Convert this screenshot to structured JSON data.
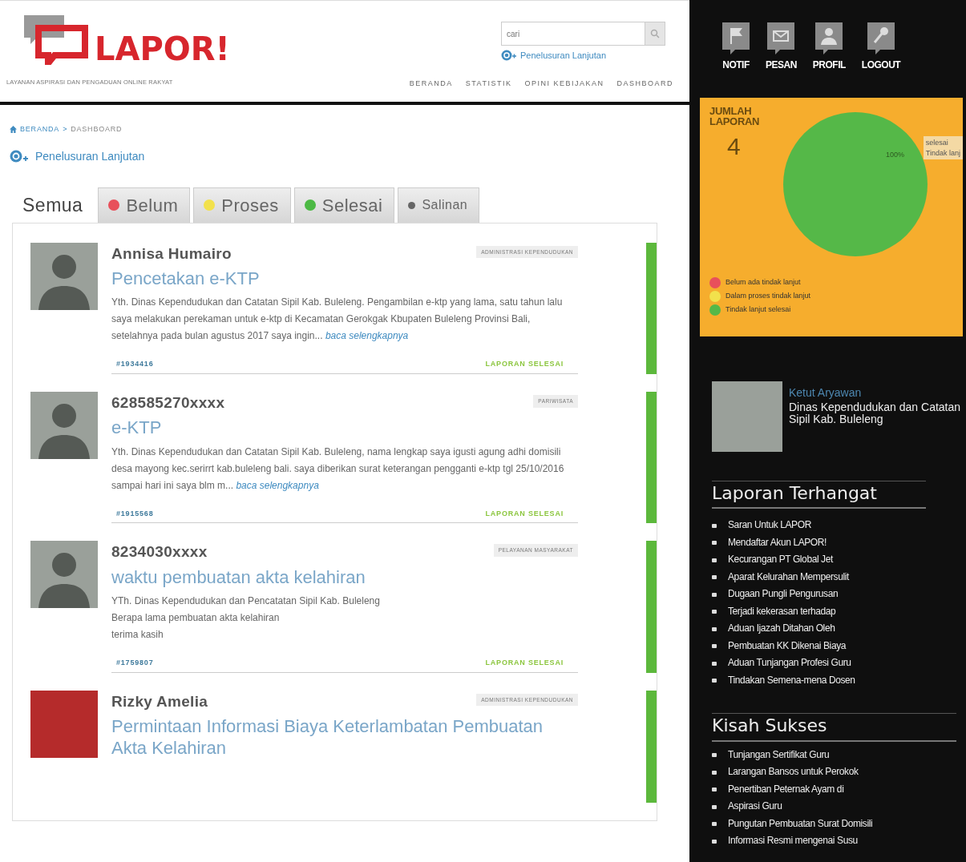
{
  "header": {
    "logo_text": "LAPOR!",
    "tagline": "LAYANAN ASPIRASI DAN PENGADUAN ONLINE RAKYAT",
    "search": {
      "placeholder": "cari"
    },
    "advanced_search": "Penelusuran Lanjutan",
    "nav": [
      "BERANDA",
      "STATISTIK",
      "OPINI KEBIJAKAN",
      "DASHBOARD"
    ]
  },
  "breadcrumb": {
    "items": [
      "BERANDA",
      "DASHBOARD"
    ],
    "separator": ">"
  },
  "advanced_search": "Penelusuran Lanjutan",
  "tabs": [
    {
      "label": "Semua",
      "selected": true
    },
    {
      "label": "Belum",
      "selected": false,
      "color": "#e8505b"
    },
    {
      "label": "Proses",
      "selected": false,
      "color": "#f2e14c"
    },
    {
      "label": "Selesai",
      "selected": false,
      "color": "#4cb944"
    },
    {
      "label": "Salinan",
      "selected": false,
      "color": "#666666"
    }
  ],
  "reports": [
    {
      "author": "Annisa Humairo",
      "has_photo": false,
      "category": "ADMINISTRASI KEPENDUDUKAN",
      "title": "Pencetakan e-KTP",
      "body": "Yth. Dinas Kependudukan dan Catatan Sipil Kab. Buleleng. Pengambilan e-ktp yang lama, satu tahun lalu saya melakukan perekaman untuk e-ktp di Kecamatan Gerokgak Kbupaten Buleleng Provinsi Bali, setelahnya pada bulan agustus 2017 saya ingin...",
      "read_more": "baca selengkapnya",
      "id": "#1934416",
      "status": "LAPORAN SELESAI",
      "color": "#5cb83c"
    },
    {
      "author": "628585270xxxx",
      "has_photo": false,
      "category": "PARIWISATA",
      "title": "e-KTP",
      "body": "Yth. Dinas Kependudukan dan Catatan Sipil Kab. Buleleng, nama lengkap saya igusti agung adhi domisili desa mayong kec.serirrt kab.buleleng bali. saya diberikan surat keterangan pengganti e-ktp tgl 25/10/2016 sampai hari ini saya blm m...",
      "read_more": "baca selengkapnya",
      "id": "#1915568",
      "status": "LAPORAN SELESAI",
      "color": "#5cb83c"
    },
    {
      "author": "8234030xxxx",
      "has_photo": false,
      "category": "PELAYANAN MASYARAKAT",
      "title": "waktu pembuatan akta kelahiran",
      "body": "YTh. Dinas Kependudukan dan Pencatatan Sipil Kab. Buleleng\nBerapa lama pembuatan akta kelahiran\nterima kasih",
      "id": "#1759807",
      "status": "LAPORAN SELESAI",
      "color": "#5cb83c"
    },
    {
      "author": "Rizky Amelia",
      "has_photo": true,
      "category": "ADMINISTRASI KEPENDUDUKAN",
      "title": "Permintaan Informasi Biaya Keterlambatan Pembuatan Akta Kelahiran",
      "color": "#5cb83c"
    }
  ],
  "user_menu": [
    {
      "label": "NOTIF",
      "kind": "flag"
    },
    {
      "label": "PESAN",
      "kind": "mail"
    },
    {
      "label": "PROFIL",
      "kind": "person"
    },
    {
      "label": "LOGOUT",
      "kind": "key"
    }
  ],
  "summary": {
    "title": "JUMLAH LAPORAN",
    "count": "4",
    "chart_data": {
      "type": "pie",
      "categories": [
        "Belum ada tindak lanjut",
        "Dalam proses tindak lanjut",
        "Tindak lanjut selesai"
      ],
      "values": [
        0,
        0,
        100
      ],
      "data_labels": true,
      "value_labels": [
        null,
        null,
        "100%"
      ]
    },
    "legend": [
      {
        "color": "#e8505b"
      },
      {
        "color": "#f2e14c"
      },
      {
        "color": "#55b848"
      }
    ],
    "tooltip": [
      "selesai",
      "Tindak lanj"
    ]
  },
  "profile": {
    "name": "Ketut Aryawan",
    "agency": "Dinas Kependudukan dan Catatan Sipil Kab. Buleleng"
  },
  "hot_reports": {
    "title": "Laporan Terhangat",
    "items": [
      "Saran Untuk LAPOR",
      "Mendaftar Akun LAPOR!",
      "Kecurangan PT Global Jet",
      "Aparat Kelurahan Mempersulit",
      "Dugaan Pungli Pengurusan",
      "Terjadi kekerasan terhadap",
      "Aduan Ijazah Ditahan Oleh",
      "Pembuatan KK Dikenai Biaya",
      "Aduan Tunjangan Profesi Guru",
      "Tindakan Semena-mena Dosen"
    ]
  },
  "success_stories": {
    "title": "Kisah Sukses",
    "items": [
      "Tunjangan Sertifikat Guru",
      "Larangan Bansos untuk Perokok",
      "Penertiban Peternak Ayam di",
      "Aspirasi Guru",
      "Pungutan Pembuatan Surat Domisili",
      "Informasi Resmi mengenai Susu"
    ]
  }
}
